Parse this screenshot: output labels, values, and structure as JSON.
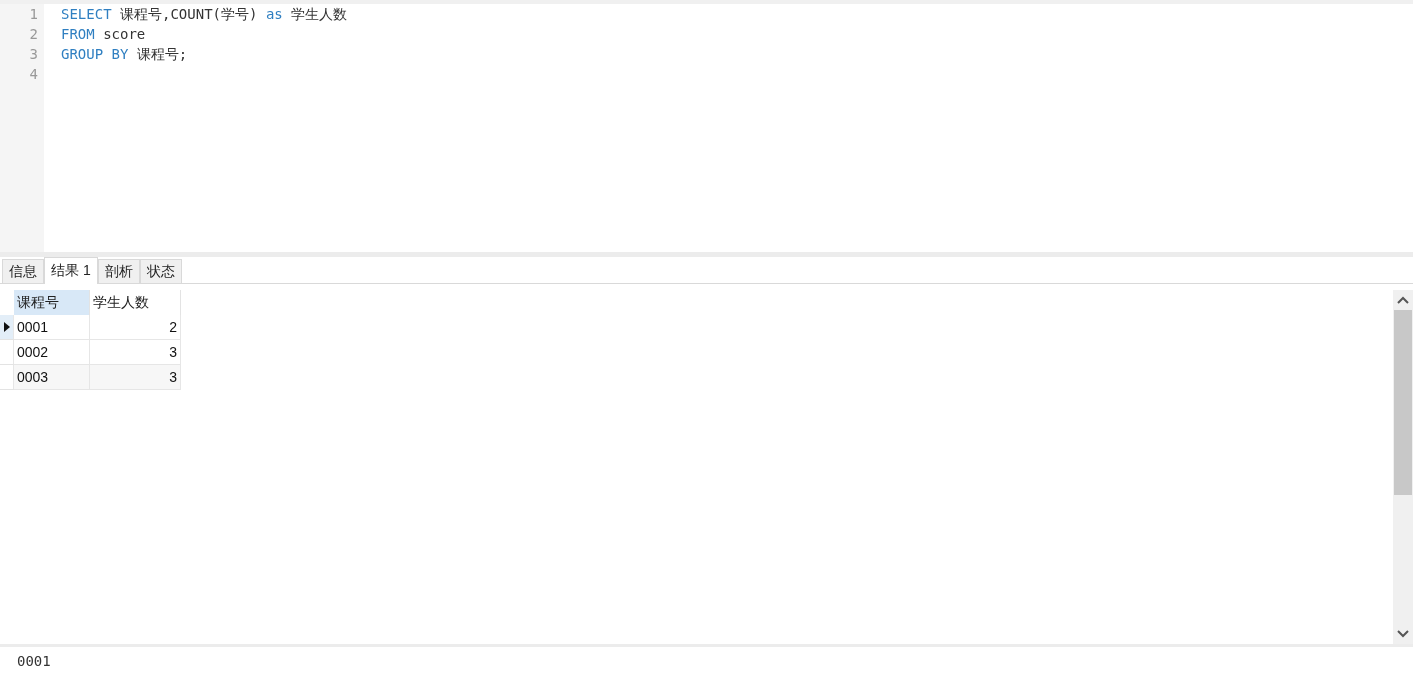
{
  "editor": {
    "lines": [
      {
        "number": "1",
        "tokens": [
          {
            "kind": "keyword",
            "text": "SELECT"
          },
          {
            "kind": "plain",
            "text": " 课程号,COUNT(学号) "
          },
          {
            "kind": "keyword",
            "text": "as"
          },
          {
            "kind": "plain",
            "text": " 学生人数"
          }
        ]
      },
      {
        "number": "2",
        "tokens": [
          {
            "kind": "keyword",
            "text": "FROM"
          },
          {
            "kind": "plain",
            "text": " score"
          }
        ]
      },
      {
        "number": "3",
        "tokens": [
          {
            "kind": "keyword",
            "text": "GROUP BY"
          },
          {
            "kind": "plain",
            "text": " 课程号;"
          }
        ]
      },
      {
        "number": "4"
      }
    ]
  },
  "tabs": [
    {
      "label": "信息",
      "selected": false
    },
    {
      "label": "结果 1",
      "selected": true
    },
    {
      "label": "剖析",
      "selected": false
    },
    {
      "label": "状态",
      "selected": false
    }
  ],
  "table": {
    "columns": [
      {
        "label": "课程号",
        "selected": true,
        "kind": "text"
      },
      {
        "label": "学生人数",
        "selected": false,
        "kind": "number"
      }
    ],
    "rows": [
      {
        "selected": true,
        "cells": [
          "0001",
          "2"
        ]
      },
      {
        "selected": false,
        "cells": [
          "0002",
          "3"
        ]
      },
      {
        "selected": false,
        "cells": [
          "0003",
          "3"
        ]
      }
    ]
  },
  "status_bar": {
    "value": "0001"
  }
}
